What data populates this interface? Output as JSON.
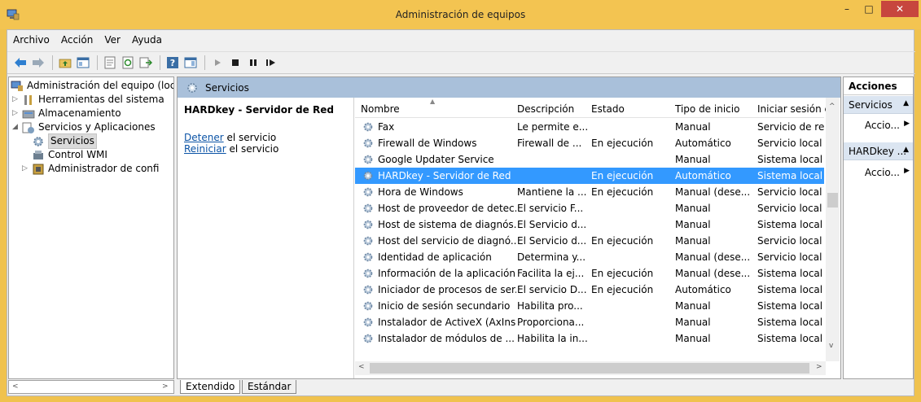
{
  "window": {
    "title": "Administración de equipos",
    "minimize": "–",
    "maximize": "□",
    "close": "✕"
  },
  "menu": [
    "Archivo",
    "Acción",
    "Ver",
    "Ayuda"
  ],
  "tree": {
    "root": "Administración del equipo (loc",
    "items": [
      {
        "label": "Herramientas del sistema",
        "exp": "▷"
      },
      {
        "label": "Almacenamiento",
        "exp": "▷"
      },
      {
        "label": "Servicios y Aplicaciones",
        "exp": "◢"
      },
      {
        "label": "Servicios",
        "exp": ""
      },
      {
        "label": "Control WMI",
        "exp": ""
      },
      {
        "label": "Administrador de confi",
        "exp": "▷"
      }
    ]
  },
  "center": {
    "header": "Servicios",
    "desc_title": "HARDkey - Servidor de Red",
    "stop_link": "Detener",
    "stop_suffix": " el servicio",
    "restart_link": "Reiniciar",
    "restart_suffix": " el servicio"
  },
  "columns": [
    "Nombre",
    "Descripción",
    "Estado",
    "Tipo de inicio",
    "Iniciar sesión c"
  ],
  "rows": [
    [
      "Fax",
      "Le permite e...",
      "",
      "Manual",
      "Servicio de red"
    ],
    [
      "Firewall de Windows",
      "Firewall de ...",
      "En ejecución",
      "Automático",
      "Servicio local"
    ],
    [
      "Google Updater Service",
      "",
      "",
      "Manual",
      "Sistema local"
    ],
    [
      "HARDkey - Servidor de Red",
      "",
      "En ejecución",
      "Automático",
      "Sistema local"
    ],
    [
      "Hora de Windows",
      "Mantiene la ...",
      "En ejecución",
      "Manual (dese...",
      "Servicio local"
    ],
    [
      "Host de proveedor de detec...",
      "El servicio F...",
      "",
      "Manual",
      "Servicio local"
    ],
    [
      "Host de sistema de diagnós...",
      "El Servicio d...",
      "",
      "Manual",
      "Sistema local"
    ],
    [
      "Host del servicio de diagnó...",
      "El Servicio d...",
      "En ejecución",
      "Manual",
      "Servicio local"
    ],
    [
      "Identidad de aplicación",
      "Determina y...",
      "",
      "Manual (dese...",
      "Servicio local"
    ],
    [
      "Información de la aplicación",
      "Facilita la ej...",
      "En ejecución",
      "Manual (dese...",
      "Sistema local"
    ],
    [
      "Iniciador de procesos de ser...",
      "El servicio D...",
      "En ejecución",
      "Automático",
      "Sistema local"
    ],
    [
      "Inicio de sesión secundario",
      "Habilita pro...",
      "",
      "Manual",
      "Sistema local"
    ],
    [
      "Instalador de ActiveX (AxIns...",
      "Proporciona...",
      "",
      "Manual",
      "Sistema local"
    ],
    [
      "Instalador de módulos de ...",
      "Habilita la in...",
      "",
      "Manual",
      "Sistema local"
    ]
  ],
  "selected_row": 3,
  "tabs": [
    "Extendido",
    "Estándar"
  ],
  "actions": {
    "title": "Acciones",
    "section1": "Servicios",
    "item1": "Accio...",
    "section2": "HARDkey ...",
    "item2": "Accio..."
  },
  "colors": {
    "selection": "#3399ff",
    "title_bar": "#f3c451",
    "header_band": "#a9c0da",
    "link": "#0b53a6"
  }
}
